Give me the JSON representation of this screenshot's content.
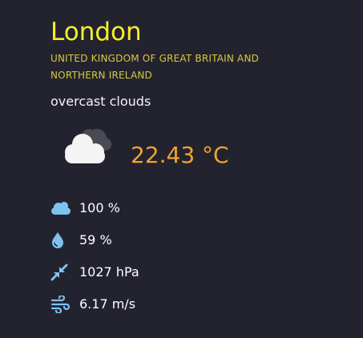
{
  "location": {
    "city": "London",
    "country": "UNITED KINGDOM OF GREAT BRITAIN AND NORTHERN IRELAND"
  },
  "weather": {
    "description": "overcast clouds",
    "icon": "overcast-clouds-icon",
    "temperature": "22.43 °C"
  },
  "details": {
    "cloudiness": {
      "icon": "cloud-icon",
      "value": "100 %"
    },
    "humidity": {
      "icon": "water-drop-icon",
      "value": "59 %"
    },
    "pressure": {
      "icon": "pressure-arrows-icon",
      "value": "1027 hPa"
    },
    "wind": {
      "icon": "wind-icon",
      "value": "6.17 m/s"
    }
  },
  "colors": {
    "background": "#23232f",
    "city": "#f6ee2c",
    "country": "#d7c93c",
    "temperature": "#f2a428",
    "detail_icon": "#7dc3ee"
  }
}
